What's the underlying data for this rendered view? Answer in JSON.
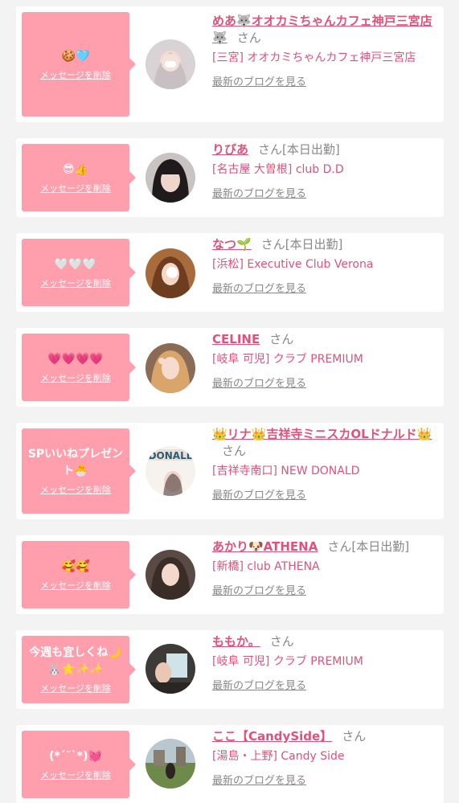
{
  "items": [
    {
      "message": "🍪🩵",
      "delete_label": "メッセージを削除",
      "name": "めあ🐺オオカミちゃんカフェ神戸三宮店🐺",
      "san": "さん",
      "status": "",
      "shop": "[三宮] オオカミちゃんカフェ神戸三宮店",
      "blog_label": "最新のブログを見る"
    },
    {
      "message": "😎👍",
      "delete_label": "メッセージを削除",
      "name": "りびあ",
      "san": "さん",
      "status": "[本日出勤]",
      "shop": "[名古屋 大曽根] club D.D",
      "blog_label": "最新のブログを見る"
    },
    {
      "message": "🤍🤍🤍",
      "delete_label": "メッセージを削除",
      "name": "なつ🌱",
      "san": "さん",
      "status": "[本日出勤]",
      "shop": "[浜松] Executive Club Verona",
      "blog_label": "最新のブログを見る"
    },
    {
      "message": "💗💗💗💗",
      "delete_label": "メッセージを削除",
      "name": "CELINE",
      "san": "さん",
      "status": "",
      "shop": "[岐阜 可児] クラブ PREMIUM",
      "blog_label": "最新のブログを見る"
    },
    {
      "message": "SPいいねプレゼント🐣",
      "delete_label": "メッセージを削除",
      "name": "👑リナ👑吉祥寺ミニスカOLドナルド👑",
      "san": "さん",
      "status": "",
      "shop": "[吉祥寺南口] NEW DONALD",
      "blog_label": "最新のブログを見る"
    },
    {
      "message": "🥰🥰",
      "delete_label": "メッセージを削除",
      "name": "あかり🐶ATHENA",
      "san": "さん",
      "status": "[本日出勤]",
      "shop": "[新橋] club ATHENA",
      "blog_label": "最新のブログを見る"
    },
    {
      "message": "今週も宜しくね🌙🐰⭐️✨✨",
      "delete_label": "メッセージを削除",
      "name": "ももか。",
      "san": "さん",
      "status": "",
      "shop": "[岐阜 可児] クラブ PREMIUM",
      "blog_label": "最新のブログを見る"
    },
    {
      "message": "(*´˘`*)💓",
      "delete_label": "メッセージを削除",
      "name": "ここ【CandySide】",
      "san": "さん",
      "status": "",
      "shop": "[湯島・上野] Candy Side",
      "blog_label": "最新のブログを見る"
    }
  ]
}
